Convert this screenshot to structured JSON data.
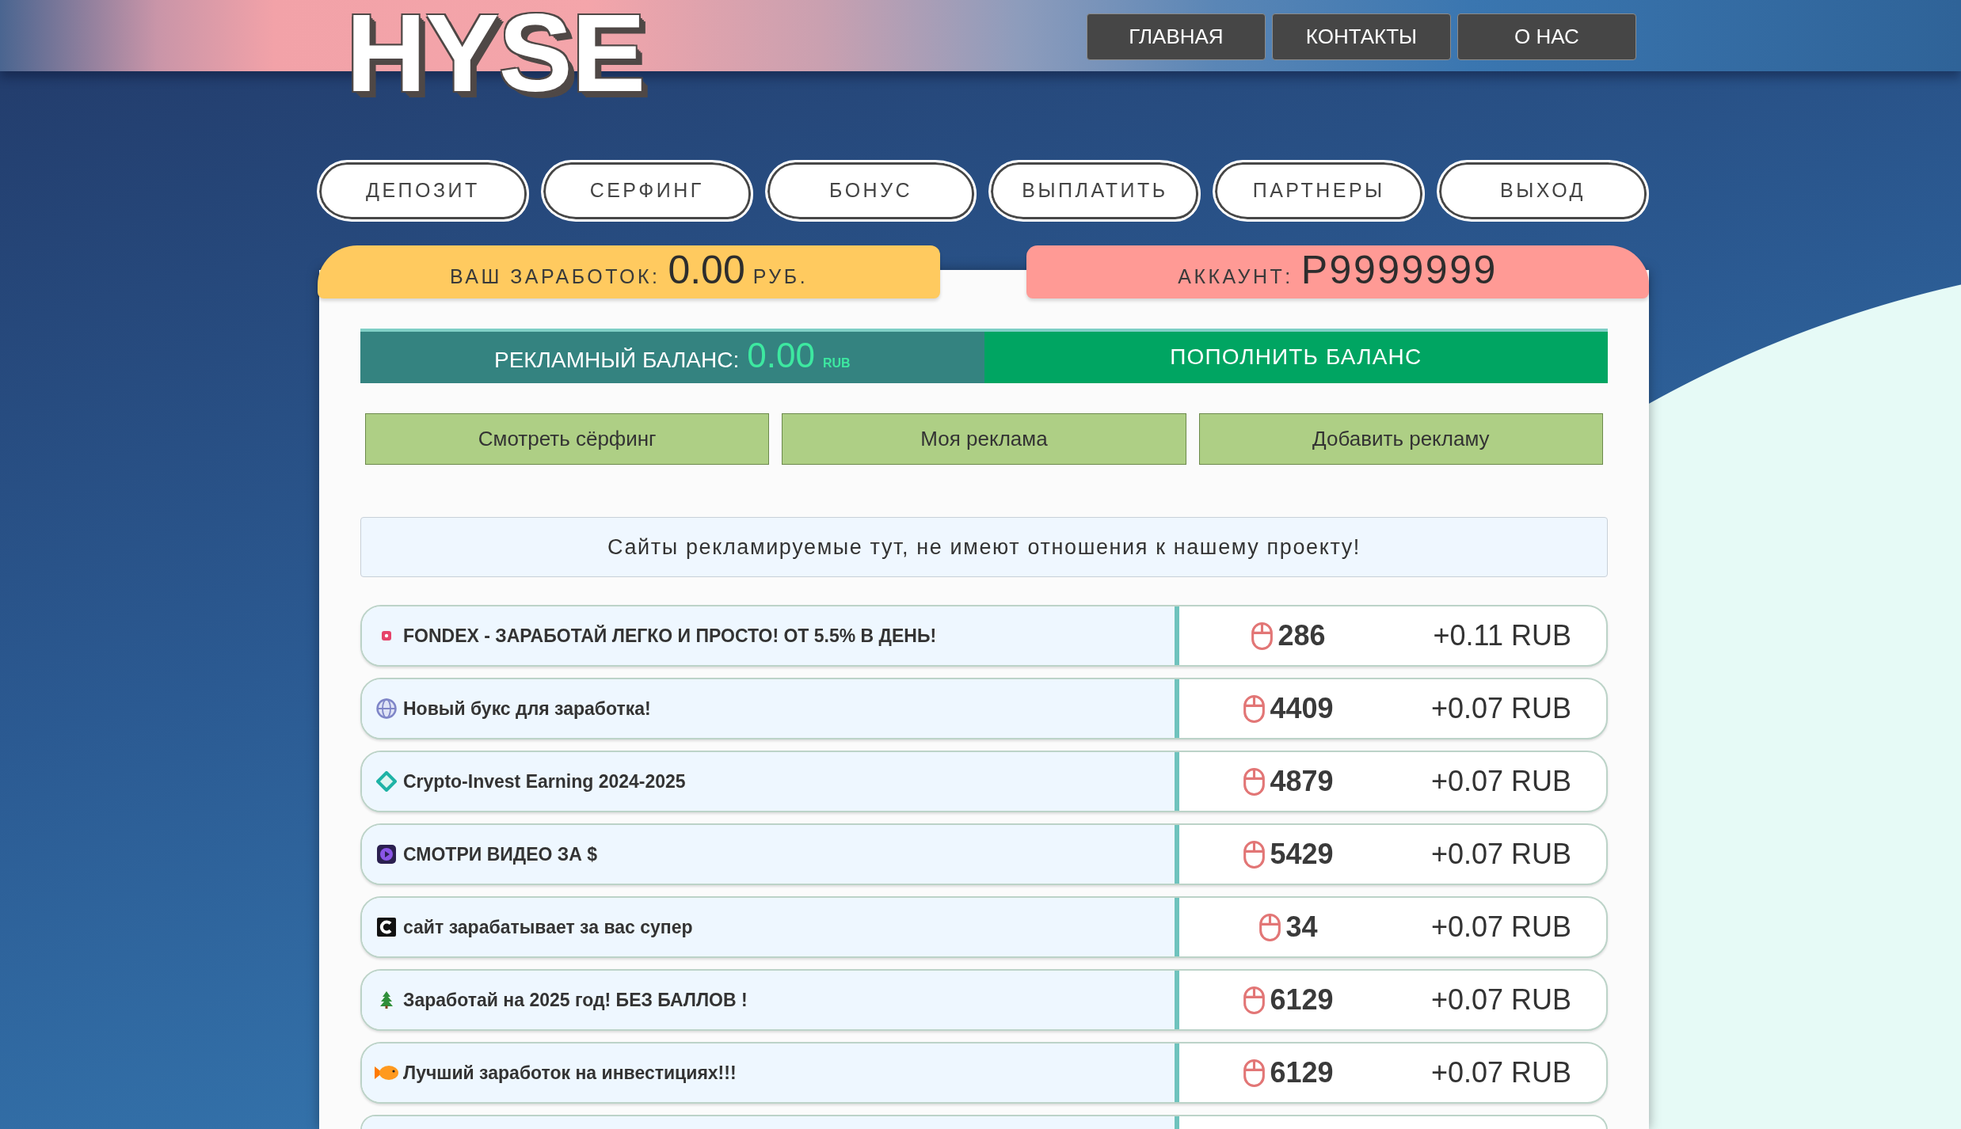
{
  "header": {
    "logo": "HYSE",
    "nav": [
      "ГЛАВНАЯ",
      "КОНТАКТЫ",
      "О НАС"
    ]
  },
  "tabs": [
    "ДЕПОЗИТ",
    "СЕРФИНГ",
    "БОНУС",
    "ВЫПЛАТИТЬ",
    "ПАРТНЕРЫ",
    "ВЫХОД"
  ],
  "earnings": {
    "label": "ВАШ ЗАРАБОТОК:",
    "value": "0.00",
    "unit": "РУБ."
  },
  "account": {
    "label": "АККАУНТ:",
    "value": "P9999999"
  },
  "ad_balance": {
    "label": "РЕКЛАМНЫЙ БАЛАНС:",
    "value": "0.00",
    "unit": "RUB",
    "button": "ПОПОЛНИТЬ БАЛАНС"
  },
  "actions": [
    "Смотреть сёрфинг",
    "Моя реклама",
    "Добавить рекламу"
  ],
  "notice": "Сайты рекламируемые тут, не имеют отношения к нашему проекту!",
  "ads": [
    {
      "kind": "dot",
      "title": "FONDEX - ЗАРАБОТАЙ ЛЕГКО И ПРОСТО! ОТ 5.5% В ДЕНЬ!",
      "clicks": "286",
      "reward": "+0.11 RUB"
    },
    {
      "kind": "globe",
      "title": "Новый букс для заработка!",
      "clicks": "4409",
      "reward": "+0.07 RUB"
    },
    {
      "kind": "diamond",
      "title": "Crypto-Invest Earning 2024-2025",
      "clicks": "4879",
      "reward": "+0.07 RUB"
    },
    {
      "kind": "play",
      "title": "СМОТРИ ВИДЕО ЗА $",
      "clicks": "5429",
      "reward": "+0.07 RUB"
    },
    {
      "kind": "letter",
      "title": "сайт зарабатывает за вас супер",
      "clicks": "34",
      "reward": "+0.07 RUB"
    },
    {
      "kind": "tree",
      "title": "Заработай на 2025 год! БЕЗ БАЛЛОВ !",
      "clicks": "6129",
      "reward": "+0.07 RUB"
    },
    {
      "kind": "fish",
      "title": "Лучший заработок на инвестициях!!!",
      "clicks": "6129",
      "reward": "+0.07 RUB"
    }
  ]
}
